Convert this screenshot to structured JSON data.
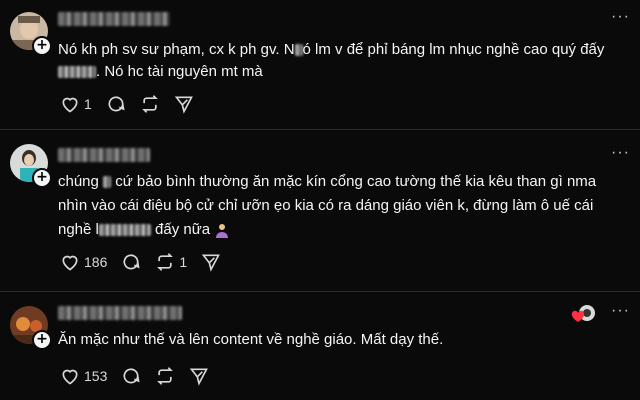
{
  "posts": [
    {
      "avatar": "avatar-1",
      "more": "···",
      "lines": [
        {
          "a": "Nó kh ph sv sư phạm, cx k ph gv. N",
          "b": "ó lm v để phỉ báng lm nhục nghề cao quý đấy"
        },
        {
          "a": ". Nó hc tài nguyên mt mà",
          "b": ""
        }
      ],
      "likes": "1",
      "comments": "",
      "reposts": ""
    },
    {
      "avatar": "avatar-2",
      "more": "···",
      "lines": [
        {
          "a": "chúng ",
          "b": " cứ bảo bình thường ăn mặc kín cổng cao tường thế kia kêu than gì nma"
        },
        {
          "a": "nhìn vào cái điệu bộ cử chỉ ưỡn ẹo kia có ra dáng giáo viên k, đừng làm ô uế cái",
          "b": ""
        },
        {
          "a": "nghề l",
          "b": " đấy nữa"
        }
      ],
      "likes": "186",
      "comments": "",
      "reposts": "1"
    },
    {
      "avatar": "avatar-3",
      "more": "···",
      "lines": [
        {
          "a": "Ăn mặc như thế và lên content về nghề giáo. Mất dạy thế.",
          "b": ""
        }
      ],
      "likes": "153",
      "comments": "",
      "reposts": ""
    }
  ],
  "icons": {
    "like": "heart-icon",
    "comment": "comment-icon",
    "repost": "repost-icon",
    "share": "send-icon",
    "more": "more-icon",
    "add": "plus-icon"
  },
  "colors": {
    "background": "#0a0a0a",
    "text": "#f3f5f7",
    "muted": "#d8d8d8",
    "heart": "#ff3040"
  }
}
